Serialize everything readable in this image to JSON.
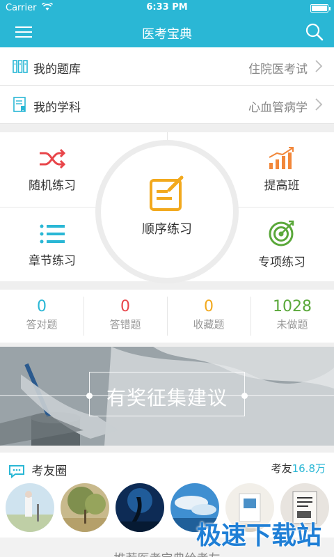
{
  "status": {
    "carrier": "Carrier",
    "time": "6:33 PM"
  },
  "nav": {
    "title": "医考宝典"
  },
  "rows": [
    {
      "label": "我的题库",
      "value": "住院医考试"
    },
    {
      "label": "我的学科",
      "value": "心血管病学"
    }
  ],
  "practice": {
    "random": "随机练习",
    "advanced": "提高班",
    "sequential": "顺序练习",
    "chapter": "章节练习",
    "special": "专项练习"
  },
  "stats": [
    {
      "num": "0",
      "label": "答对题",
      "color": "#2ab7d5"
    },
    {
      "num": "0",
      "label": "答错题",
      "color": "#e8454a"
    },
    {
      "num": "0",
      "label": "收藏题",
      "color": "#f2a91e"
    },
    {
      "num": "1028",
      "label": "未做题",
      "color": "#5aa83a"
    }
  ],
  "banner": {
    "text": "有奖征集建议"
  },
  "friends": {
    "title": "考友圈",
    "count_label": "考友",
    "count_value": "16.8万"
  },
  "bottom": {
    "text": "推荐医考宝典给考友"
  },
  "watermark": "极速下载站",
  "colors": {
    "brand": "#2ab7d5"
  }
}
